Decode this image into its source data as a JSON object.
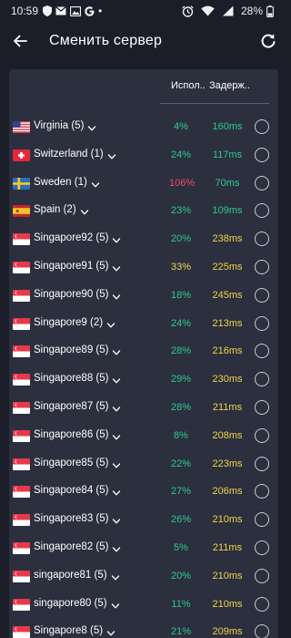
{
  "status": {
    "time": "10:59",
    "dot": "•",
    "battery": "28%"
  },
  "header": {
    "title": "Сменить сервер"
  },
  "columns": {
    "usage": "Испол..",
    "delay": "Задерж.."
  },
  "colors": {
    "green": "#2fcb8a",
    "yellow": "#f1d44a",
    "red": "#f04b63"
  },
  "servers": [
    {
      "name": "Virginia (5)",
      "flag": "us",
      "usage": "4%",
      "latency": "160ms",
      "usage_color": "green",
      "latency_color": "green"
    },
    {
      "name": "Switzerland (1)",
      "flag": "ch",
      "usage": "24%",
      "latency": "117ms",
      "usage_color": "green",
      "latency_color": "green"
    },
    {
      "name": "Sweden (1)",
      "flag": "se",
      "usage": "106%",
      "latency": "70ms",
      "usage_color": "red",
      "latency_color": "green"
    },
    {
      "name": "Spain (2)",
      "flag": "es",
      "usage": "23%",
      "latency": "109ms",
      "usage_color": "green",
      "latency_color": "green"
    },
    {
      "name": "Singapore92 (5)",
      "flag": "sg",
      "usage": "20%",
      "latency": "238ms",
      "usage_color": "green",
      "latency_color": "yellow"
    },
    {
      "name": "Singapore91 (5)",
      "flag": "sg",
      "usage": "33%",
      "latency": "225ms",
      "usage_color": "yellow",
      "latency_color": "yellow"
    },
    {
      "name": "Singapore90 (5)",
      "flag": "sg",
      "usage": "18%",
      "latency": "245ms",
      "usage_color": "green",
      "latency_color": "yellow"
    },
    {
      "name": "Singapore9 (2)",
      "flag": "sg",
      "usage": "24%",
      "latency": "213ms",
      "usage_color": "green",
      "latency_color": "yellow"
    },
    {
      "name": "Singapore89 (5)",
      "flag": "sg",
      "usage": "28%",
      "latency": "216ms",
      "usage_color": "green",
      "latency_color": "yellow"
    },
    {
      "name": "Singapore88 (5)",
      "flag": "sg",
      "usage": "29%",
      "latency": "230ms",
      "usage_color": "green",
      "latency_color": "yellow"
    },
    {
      "name": "Singapore87 (5)",
      "flag": "sg",
      "usage": "28%",
      "latency": "211ms",
      "usage_color": "green",
      "latency_color": "yellow"
    },
    {
      "name": "Singapore86 (5)",
      "flag": "sg",
      "usage": "8%",
      "latency": "208ms",
      "usage_color": "green",
      "latency_color": "yellow"
    },
    {
      "name": "Singapore85 (5)",
      "flag": "sg",
      "usage": "22%",
      "latency": "223ms",
      "usage_color": "green",
      "latency_color": "yellow"
    },
    {
      "name": "Singapore84 (5)",
      "flag": "sg",
      "usage": "27%",
      "latency": "206ms",
      "usage_color": "green",
      "latency_color": "yellow"
    },
    {
      "name": "Singapore83 (5)",
      "flag": "sg",
      "usage": "26%",
      "latency": "210ms",
      "usage_color": "green",
      "latency_color": "yellow"
    },
    {
      "name": "Singapore82 (5)",
      "flag": "sg",
      "usage": "5%",
      "latency": "211ms",
      "usage_color": "green",
      "latency_color": "yellow"
    },
    {
      "name": "singapore81 (5)",
      "flag": "sg",
      "usage": "20%",
      "latency": "210ms",
      "usage_color": "green",
      "latency_color": "yellow"
    },
    {
      "name": "singapore80 (5)",
      "flag": "sg",
      "usage": "11%",
      "latency": "210ms",
      "usage_color": "green",
      "latency_color": "yellow"
    },
    {
      "name": "Singapore8 (5)",
      "flag": "sg",
      "usage": "21%",
      "latency": "209ms",
      "usage_color": "green",
      "latency_color": "yellow"
    }
  ]
}
